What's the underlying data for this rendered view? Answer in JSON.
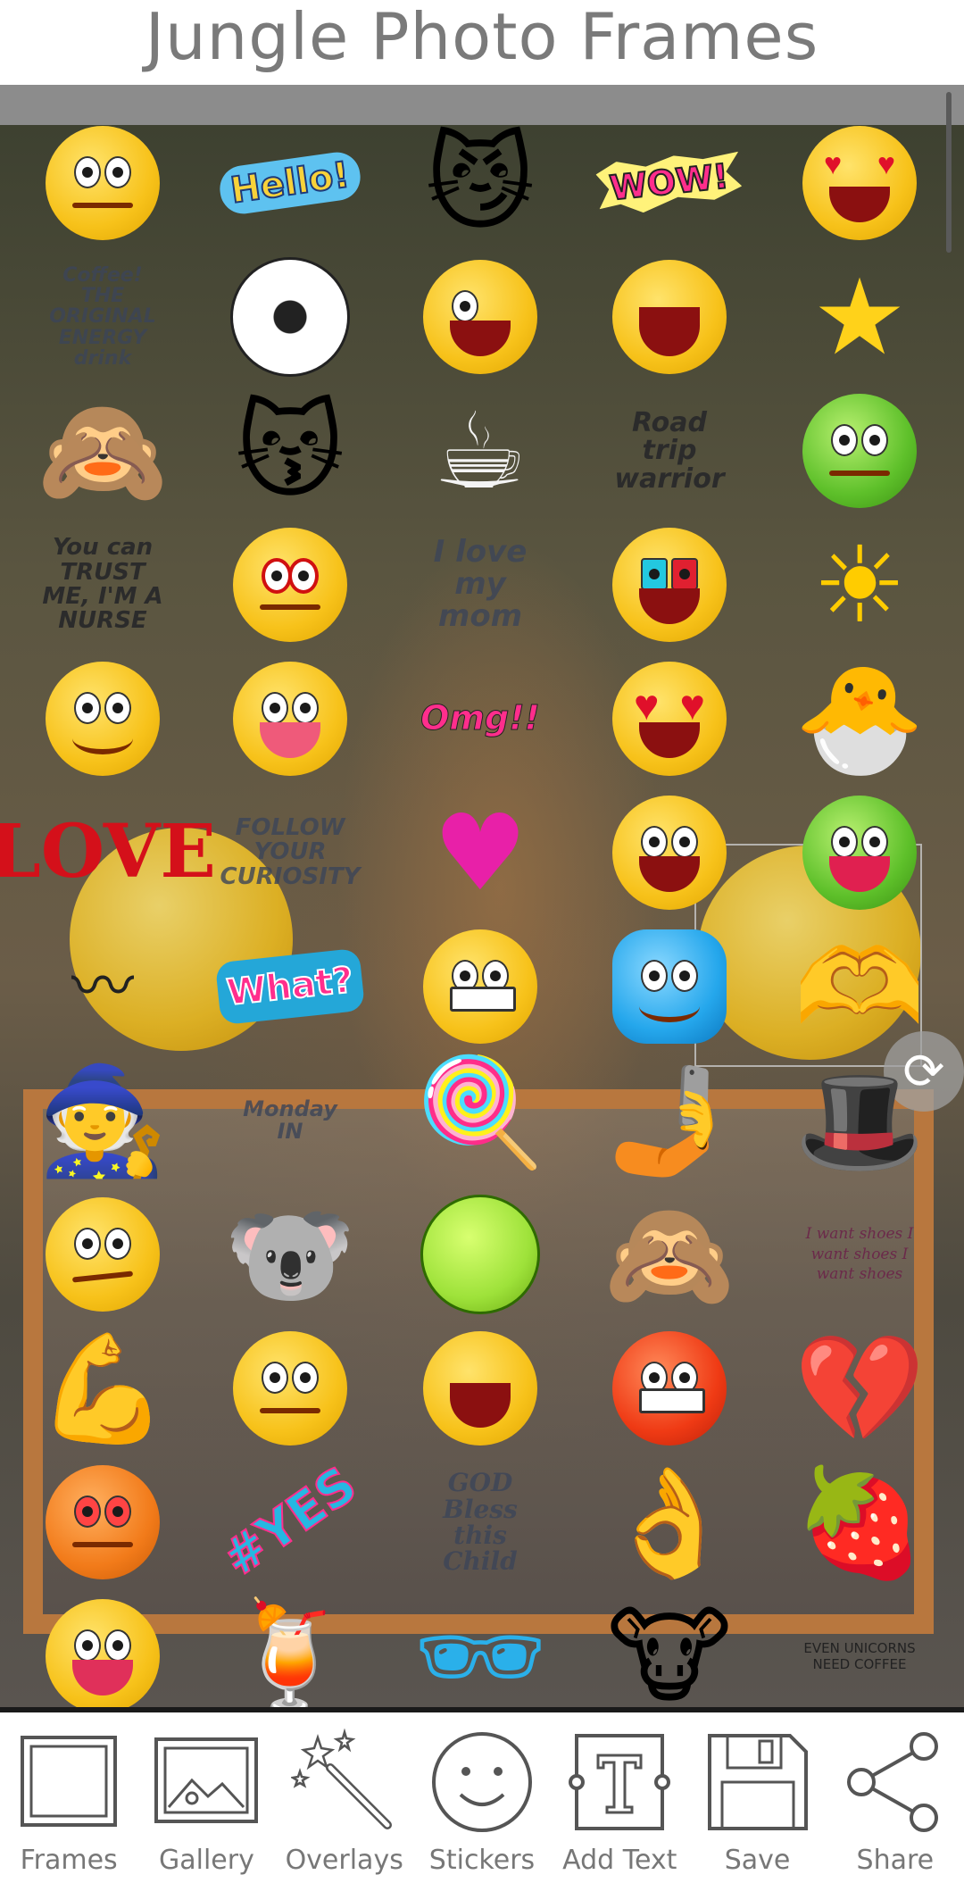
{
  "app": {
    "title": "Jungle Photo Frames"
  },
  "stickers": {
    "hello": "Hello!",
    "wow": "WOW!",
    "coffee": "Coffee! THE ORIGINAL ENERGY drink",
    "road_trip": "Road trip warrior",
    "nurse": "You can TRUST ME, I'M A NURSE",
    "mom": "I love my mom",
    "omg": "Omg!!",
    "love": "LOVE",
    "follow": "FOLLOW YOUR CURIOSITY",
    "what": "What?",
    "monday": "Monday IN",
    "shoes": "I want shoes I want shoes I want shoes",
    "god_bless": "GOD Bless this Child",
    "yes": "#YES",
    "unicorn": "EVEN UNICORNS NEED COFFEE"
  },
  "toolbar": {
    "items": [
      {
        "label": "Frames",
        "icon": "frame-icon"
      },
      {
        "label": "Gallery",
        "icon": "gallery-icon"
      },
      {
        "label": "Overlays",
        "icon": "magic-wand-icon"
      },
      {
        "label": "Stickers",
        "icon": "smiley-icon"
      },
      {
        "label": "Add Text",
        "icon": "text-icon"
      },
      {
        "label": "Save",
        "icon": "floppy-disk-icon"
      },
      {
        "label": "Share",
        "icon": "share-icon"
      }
    ]
  },
  "colors": {
    "title": "#7a7a7a",
    "toolbar_label": "#777777",
    "frame_border": "#b8773e",
    "toolbar_border": "#1a1a1a"
  }
}
